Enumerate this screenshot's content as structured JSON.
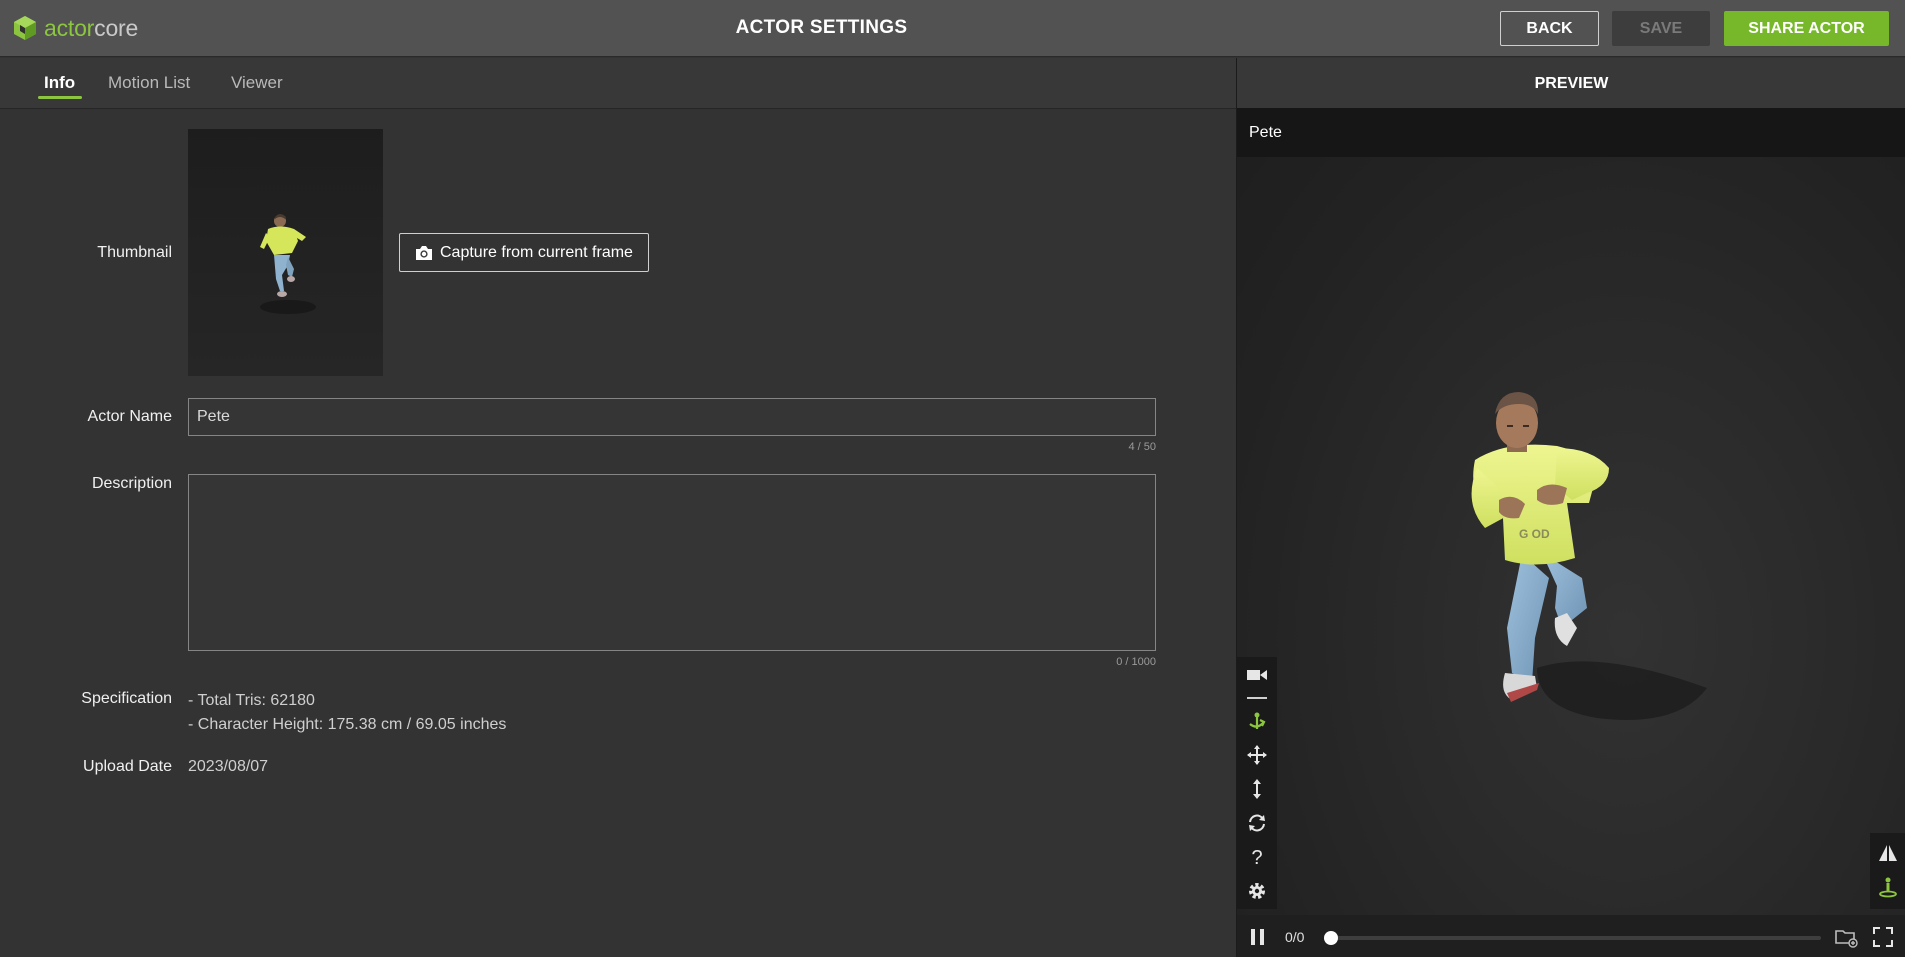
{
  "app": {
    "logo_part1": "actor",
    "logo_part2": "core",
    "title": "ACTOR SETTINGS"
  },
  "header_buttons": {
    "back": "BACK",
    "save": "SAVE",
    "share": "SHARE ACTOR"
  },
  "tabs": [
    {
      "label": "Info",
      "active": true
    },
    {
      "label": "Motion List",
      "active": false
    },
    {
      "label": "Viewer",
      "active": false
    }
  ],
  "form": {
    "thumbnail_label": "Thumbnail",
    "capture_label": "Capture from current frame",
    "actor_name_label": "Actor Name",
    "actor_name_value": "Pete",
    "actor_name_counter": "4 / 50",
    "description_label": "Description",
    "description_value": "",
    "description_counter": "0 / 1000",
    "specification_label": "Specification",
    "spec_lines": [
      "- Total Tris: 62180",
      "- Character Height: 175.38 cm / 69.05 inches"
    ],
    "upload_date_label": "Upload Date",
    "upload_date_value": "2023/08/07"
  },
  "preview": {
    "header": "PREVIEW",
    "actor_name": "Pete",
    "frame_counter": "0/0"
  },
  "tools": [
    "camera-icon",
    "orbit-icon",
    "move-icon",
    "vertical-move-icon",
    "rotate-icon",
    "help-icon",
    "settings-icon"
  ],
  "colors": {
    "accent": "#76b82a",
    "topbar": "#525252",
    "panel": "#333333",
    "viewer": "#262626"
  }
}
